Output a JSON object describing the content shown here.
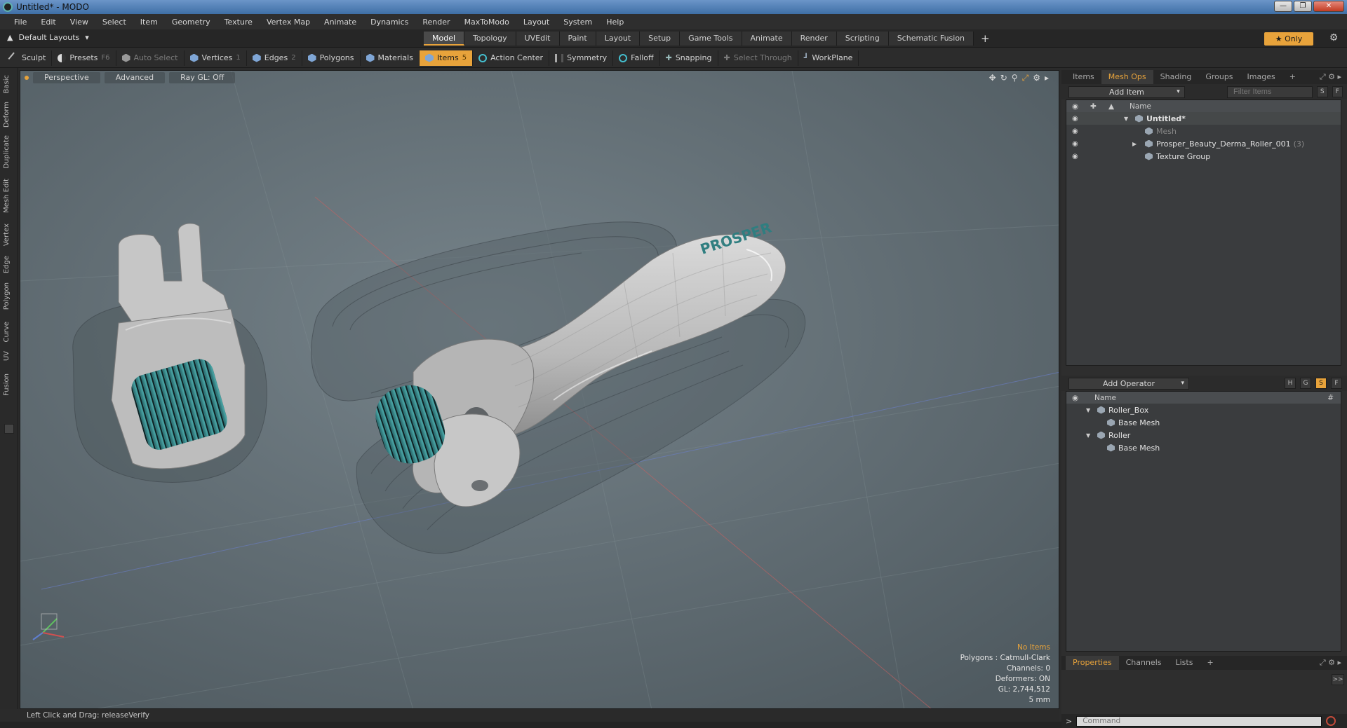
{
  "window": {
    "title": "Untitled* - MODO"
  },
  "menu": [
    "File",
    "Edit",
    "View",
    "Select",
    "Item",
    "Geometry",
    "Texture",
    "Vertex Map",
    "Animate",
    "Dynamics",
    "Render",
    "MaxToModo",
    "Layout",
    "System",
    "Help"
  ],
  "layout": {
    "dropdown": "Default Layouts",
    "tabs": [
      "Model",
      "Topology",
      "UVEdit",
      "Paint",
      "Layout",
      "Setup",
      "Game Tools",
      "Animate",
      "Render",
      "Scripting",
      "Schematic Fusion"
    ],
    "active_tab": "Model",
    "only_label": "Only"
  },
  "toolbar": {
    "sculpt": "Sculpt",
    "presets": "Presets",
    "presets_key": "F6",
    "auto_select": "Auto Select",
    "vertices": "Vertices",
    "vertices_key": "1",
    "edges": "Edges",
    "edges_key": "2",
    "polygons": "Polygons",
    "materials": "Materials",
    "items": "Items",
    "items_key": "5",
    "action_center": "Action Center",
    "symmetry": "Symmetry",
    "falloff": "Falloff",
    "snapping": "Snapping",
    "select_through": "Select Through",
    "workplane": "WorkPlane"
  },
  "left_tabs": [
    "Basic",
    "Deform",
    "Duplicate",
    "Mesh Edit",
    "Vertex",
    "Edge",
    "Polygon",
    "Curve",
    "UV",
    "Fusion"
  ],
  "viewport": {
    "perspective": "Perspective",
    "advanced": "Advanced",
    "raygl": "Ray GL: Off",
    "stats": {
      "no_items": "No Items",
      "polygons": "Polygons : Catmull-Clark",
      "channels": "Channels: 0",
      "deformers": "Deformers: ON",
      "gl": "GL: 2,744,512",
      "scale": "5 mm"
    },
    "logo_text": "PROSPER"
  },
  "status": {
    "text": "Left Click and Drag:  releaseVerify"
  },
  "items_panel": {
    "tabs": [
      "Items",
      "Mesh Ops",
      "Shading",
      "Groups",
      "Images"
    ],
    "active_tab": "Mesh Ops",
    "add_item": "Add Item",
    "filter_placeholder": "Filter Items",
    "s_label": "S",
    "f_label": "F",
    "col_name": "Name",
    "tree": [
      {
        "label": "Untitled*",
        "bold": true
      },
      {
        "label": "Mesh",
        "dim": true
      },
      {
        "label": "Prosper_Beauty_Derma_Roller_001",
        "count": "(3)"
      },
      {
        "label": "Texture Group"
      }
    ]
  },
  "operators_panel": {
    "add_operator": "Add Operator",
    "h_label": "H",
    "g_label": "G",
    "s_label": "S",
    "f_label": "F",
    "col_name": "Name",
    "col_hash": "#",
    "tree": [
      {
        "label": "Roller_Box"
      },
      {
        "label": "Base Mesh"
      },
      {
        "label": "Roller"
      },
      {
        "label": "Base Mesh"
      }
    ]
  },
  "props_panel": {
    "tabs": [
      "Properties",
      "Channels",
      "Lists"
    ],
    "active_tab": "Properties",
    "more": ">>"
  },
  "command": {
    "placeholder": "Command",
    "arrow": ">"
  }
}
